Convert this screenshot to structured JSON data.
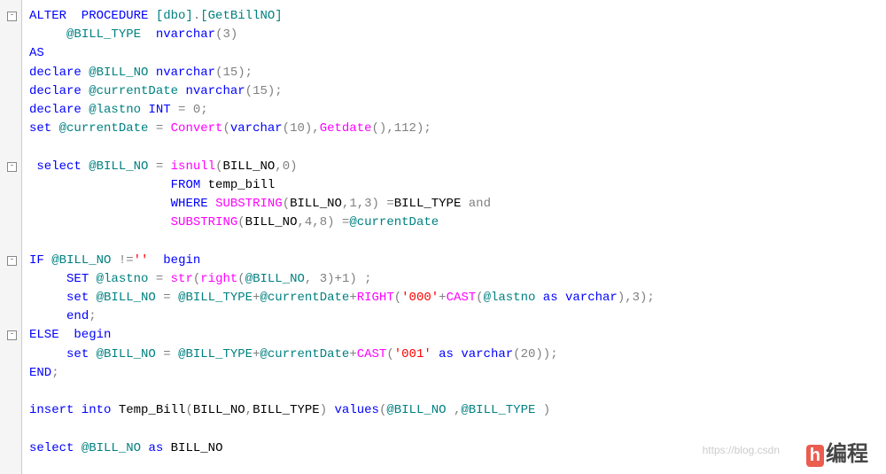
{
  "code": {
    "lines": [
      {
        "indent": 0,
        "tokens": [
          [
            "kw-blue",
            "ALTER  PROCEDURE "
          ],
          [
            "kw-teal",
            "[dbo]"
          ],
          [
            "op-gray",
            "."
          ],
          [
            "kw-teal",
            "[GetBillNO]"
          ]
        ]
      },
      {
        "indent": 5,
        "tokens": [
          [
            "kw-teal",
            "@BILL_TYPE  "
          ],
          [
            "kw-blue",
            "nvarchar"
          ],
          [
            "op-gray",
            "("
          ],
          [
            "num-gray",
            "3"
          ],
          [
            "op-gray",
            ")"
          ]
        ]
      },
      {
        "indent": 0,
        "tokens": [
          [
            "kw-blue",
            "AS"
          ]
        ]
      },
      {
        "indent": 0,
        "tokens": [
          [
            "kw-blue",
            "declare "
          ],
          [
            "kw-teal",
            "@BILL_NO "
          ],
          [
            "kw-blue",
            "nvarchar"
          ],
          [
            "op-gray",
            "("
          ],
          [
            "num-gray",
            "15"
          ],
          [
            "op-gray",
            ");"
          ]
        ]
      },
      {
        "indent": 0,
        "tokens": [
          [
            "kw-blue",
            "declare "
          ],
          [
            "kw-teal",
            "@currentDate "
          ],
          [
            "kw-blue",
            "nvarchar"
          ],
          [
            "op-gray",
            "("
          ],
          [
            "num-gray",
            "15"
          ],
          [
            "op-gray",
            ");"
          ]
        ]
      },
      {
        "indent": 0,
        "tokens": [
          [
            "kw-blue",
            "declare "
          ],
          [
            "kw-teal",
            "@lastno "
          ],
          [
            "kw-blue",
            "INT "
          ],
          [
            "op-gray",
            "= "
          ],
          [
            "num-gray",
            "0"
          ],
          [
            "op-gray",
            ";"
          ]
        ]
      },
      {
        "indent": 0,
        "tokens": [
          [
            "kw-blue",
            "set "
          ],
          [
            "kw-teal",
            "@currentDate "
          ],
          [
            "op-gray",
            "= "
          ],
          [
            "fn-mag",
            "Convert"
          ],
          [
            "op-gray",
            "("
          ],
          [
            "kw-blue",
            "varchar"
          ],
          [
            "op-gray",
            "("
          ],
          [
            "num-gray",
            "10"
          ],
          [
            "op-gray",
            "),"
          ],
          [
            "fn-mag",
            "Getdate"
          ],
          [
            "op-gray",
            "(),"
          ],
          [
            "num-gray",
            "112"
          ],
          [
            "op-gray",
            ");"
          ]
        ]
      },
      {
        "indent": 0,
        "tokens": []
      },
      {
        "indent": 1,
        "tokens": [
          [
            "kw-blue",
            "select "
          ],
          [
            "kw-teal",
            "@BILL_NO "
          ],
          [
            "op-gray",
            "= "
          ],
          [
            "fn-mag",
            "isnull"
          ],
          [
            "op-gray",
            "("
          ],
          [
            "id",
            "BILL_NO"
          ],
          [
            "op-gray",
            ","
          ],
          [
            "num-gray",
            "0"
          ],
          [
            "op-gray",
            ")"
          ]
        ]
      },
      {
        "indent": 19,
        "tokens": [
          [
            "kw-blue",
            "FROM "
          ],
          [
            "id",
            "temp_bill"
          ]
        ]
      },
      {
        "indent": 19,
        "tokens": [
          [
            "kw-blue",
            "WHERE "
          ],
          [
            "fn-mag",
            "SUBSTRING"
          ],
          [
            "op-gray",
            "("
          ],
          [
            "id",
            "BILL_NO"
          ],
          [
            "op-gray",
            ","
          ],
          [
            "num-gray",
            "1"
          ],
          [
            "op-gray",
            ","
          ],
          [
            "num-gray",
            "3"
          ],
          [
            "op-gray",
            ") ="
          ],
          [
            "id",
            "BILL_TYPE "
          ],
          [
            "kw-gray",
            "and"
          ]
        ]
      },
      {
        "indent": 19,
        "tokens": [
          [
            "fn-mag",
            "SUBSTRING"
          ],
          [
            "op-gray",
            "("
          ],
          [
            "id",
            "BILL_NO"
          ],
          [
            "op-gray",
            ","
          ],
          [
            "num-gray",
            "4"
          ],
          [
            "op-gray",
            ","
          ],
          [
            "num-gray",
            "8"
          ],
          [
            "op-gray",
            ") ="
          ],
          [
            "kw-teal",
            "@currentDate"
          ]
        ]
      },
      {
        "indent": 0,
        "tokens": []
      },
      {
        "indent": 0,
        "tokens": [
          [
            "kw-blue",
            "IF "
          ],
          [
            "kw-teal",
            "@BILL_NO "
          ],
          [
            "op-gray",
            "!="
          ],
          [
            "str-red",
            "''"
          ],
          [
            "kw-blue",
            "  begin"
          ]
        ]
      },
      {
        "indent": 5,
        "tokens": [
          [
            "kw-blue",
            "SET "
          ],
          [
            "kw-teal",
            "@lastno "
          ],
          [
            "op-gray",
            "= "
          ],
          [
            "fn-mag",
            "str"
          ],
          [
            "op-gray",
            "("
          ],
          [
            "fn-mag",
            "right"
          ],
          [
            "op-gray",
            "("
          ],
          [
            "kw-teal",
            "@BILL_NO"
          ],
          [
            "op-gray",
            ", "
          ],
          [
            "num-gray",
            "3"
          ],
          [
            "op-gray",
            ")+"
          ],
          [
            "num-gray",
            "1"
          ],
          [
            "op-gray",
            ") ;"
          ]
        ]
      },
      {
        "indent": 5,
        "tokens": [
          [
            "kw-blue",
            "set "
          ],
          [
            "kw-teal",
            "@BILL_NO "
          ],
          [
            "op-gray",
            "= "
          ],
          [
            "kw-teal",
            "@BILL_TYPE"
          ],
          [
            "op-gray",
            "+"
          ],
          [
            "kw-teal",
            "@currentDate"
          ],
          [
            "op-gray",
            "+"
          ],
          [
            "fn-mag",
            "RIGHT"
          ],
          [
            "op-gray",
            "("
          ],
          [
            "str-red",
            "'000'"
          ],
          [
            "op-gray",
            "+"
          ],
          [
            "fn-mag",
            "CAST"
          ],
          [
            "op-gray",
            "("
          ],
          [
            "kw-teal",
            "@lastno "
          ],
          [
            "kw-blue",
            "as varchar"
          ],
          [
            "op-gray",
            "),"
          ],
          [
            "num-gray",
            "3"
          ],
          [
            "op-gray",
            ");"
          ]
        ]
      },
      {
        "indent": 5,
        "tokens": [
          [
            "kw-blue",
            "end"
          ],
          [
            "op-gray",
            ";"
          ]
        ]
      },
      {
        "indent": 0,
        "tokens": [
          [
            "kw-blue",
            "ELSE  begin"
          ]
        ]
      },
      {
        "indent": 5,
        "tokens": [
          [
            "kw-blue",
            "set "
          ],
          [
            "kw-teal",
            "@BILL_NO "
          ],
          [
            "op-gray",
            "= "
          ],
          [
            "kw-teal",
            "@BILL_TYPE"
          ],
          [
            "op-gray",
            "+"
          ],
          [
            "kw-teal",
            "@currentDate"
          ],
          [
            "op-gray",
            "+"
          ],
          [
            "fn-mag",
            "CAST"
          ],
          [
            "op-gray",
            "("
          ],
          [
            "str-red",
            "'001'"
          ],
          [
            "kw-blue",
            " as varchar"
          ],
          [
            "op-gray",
            "("
          ],
          [
            "num-gray",
            "20"
          ],
          [
            "op-gray",
            "));"
          ]
        ]
      },
      {
        "indent": 0,
        "tokens": [
          [
            "kw-blue",
            "END"
          ],
          [
            "op-gray",
            ";"
          ]
        ]
      },
      {
        "indent": 0,
        "tokens": []
      },
      {
        "indent": 0,
        "tokens": [
          [
            "kw-blue",
            "insert into "
          ],
          [
            "id",
            "Temp_Bill"
          ],
          [
            "op-gray",
            "("
          ],
          [
            "id",
            "BILL_NO"
          ],
          [
            "op-gray",
            ","
          ],
          [
            "id",
            "BILL_TYPE"
          ],
          [
            "op-gray",
            ") "
          ],
          [
            "kw-blue",
            "values"
          ],
          [
            "op-gray",
            "("
          ],
          [
            "kw-teal",
            "@BILL_NO "
          ],
          [
            "op-gray",
            ","
          ],
          [
            "kw-teal",
            "@BILL_TYPE "
          ],
          [
            "op-gray",
            ")"
          ]
        ]
      },
      {
        "indent": 0,
        "tokens": []
      },
      {
        "indent": 0,
        "tokens": [
          [
            "kw-blue",
            "select "
          ],
          [
            "kw-teal",
            "@BILL_NO "
          ],
          [
            "kw-blue",
            "as "
          ],
          [
            "id",
            "BILL_NO"
          ]
        ]
      }
    ]
  },
  "folds": [
    {
      "line": 0,
      "state": "-"
    },
    {
      "line": 8,
      "state": "-"
    },
    {
      "line": 13,
      "state": "-"
    },
    {
      "line": 17,
      "state": "-"
    }
  ],
  "watermark": {
    "logo": "h",
    "text": "编程",
    "url": "https://blog.csdn"
  }
}
